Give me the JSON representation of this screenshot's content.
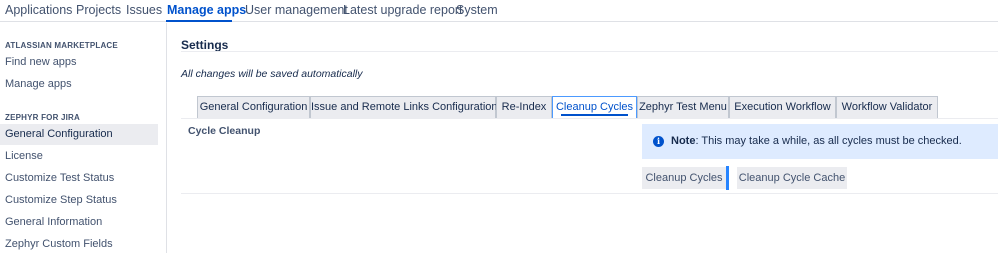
{
  "topnav": {
    "items": [
      "Applications",
      "Projects",
      "Issues",
      "Manage apps",
      "User management",
      "Latest upgrade report",
      "System"
    ],
    "active": "Manage apps"
  },
  "sidebar": {
    "sections": [
      {
        "heading": "ATLASSIAN MARKETPLACE",
        "items": [
          "Find new apps",
          "Manage apps"
        ]
      },
      {
        "heading": "ZEPHYR FOR JIRA",
        "items": [
          "General Configuration",
          "License",
          "Customize Test Status",
          "Customize Step Status",
          "General Information",
          "Zephyr Custom Fields"
        ]
      }
    ],
    "active_item": "General Configuration"
  },
  "main": {
    "title": "Settings",
    "autosave_text": "All changes will be saved automatically",
    "tabs": [
      "General Configuration",
      "Issue and Remote Links Configuration",
      "Re-Index",
      "Cleanup Cycles",
      "Zephyr Test Menu",
      "Execution Workflow",
      "Workflow Validator"
    ],
    "active_tab": "Cleanup Cycles",
    "section_label": "Cycle Cleanup",
    "note": {
      "label": "Note",
      "text": ": This may take a while, as all cycles must be checked.",
      "icon": "info-icon"
    },
    "buttons": {
      "cleanup_cycles": "Cleanup Cycles",
      "cleanup_cycle_cache": "Cleanup Cycle Cache"
    }
  },
  "colors": {
    "accent": "#0052cc",
    "note_background": "#deebff",
    "button_background": "#ebecf0",
    "separator": "#2684ff"
  }
}
